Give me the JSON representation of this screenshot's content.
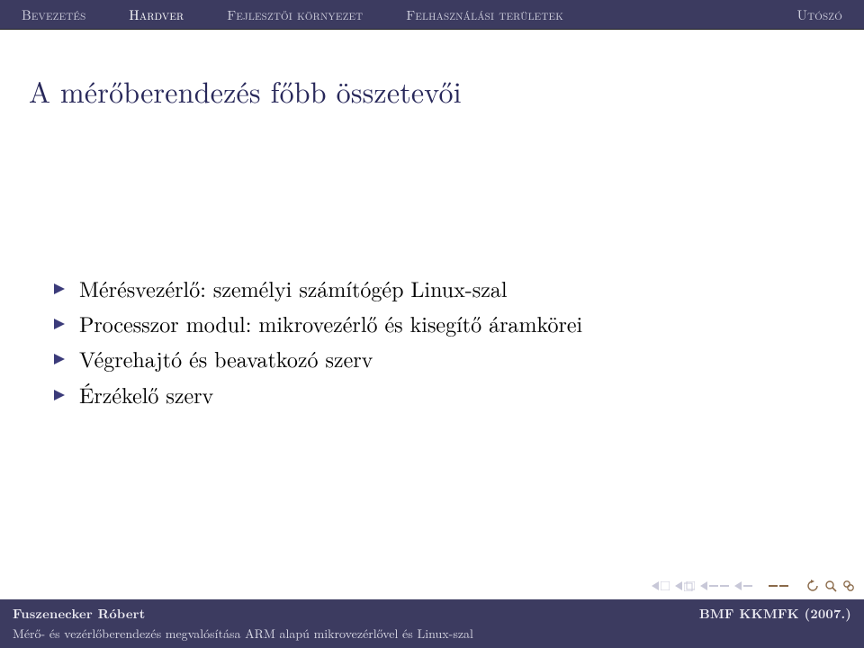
{
  "nav": {
    "items": [
      {
        "label": "Bevezetés"
      },
      {
        "label": "Hardver"
      },
      {
        "label": "Fejlesztői környezet"
      },
      {
        "label": "Felhasználási területek"
      },
      {
        "label": "Utószó"
      }
    ],
    "current_index": 1
  },
  "title": "A mérőberendezés főbb összetevői",
  "bullets": [
    "Mérésvezérlő: személyi számítógép Linux-szal",
    "Processzor modul: mikrovezérlő és kisegítő áramkörei",
    "Végrehajtó és beavatkozó szerv",
    "Érzékelő szerv"
  ],
  "footer": {
    "author": "Fuszenecker Róbert",
    "affiliation": "BMF KKMFK (2007.)",
    "subtitle": "Mérő- és vezérlőberendezés megvalósítása ARM alapú mikrovezérlővel és Linux-szal"
  },
  "colors": {
    "navbar_bg": "#3c3b60",
    "title": "#28285a",
    "bullet_tri": "#3b3b7a",
    "ctrl_muted": "#bcbcd2",
    "ctrl_accent": "#3c3b8c"
  }
}
